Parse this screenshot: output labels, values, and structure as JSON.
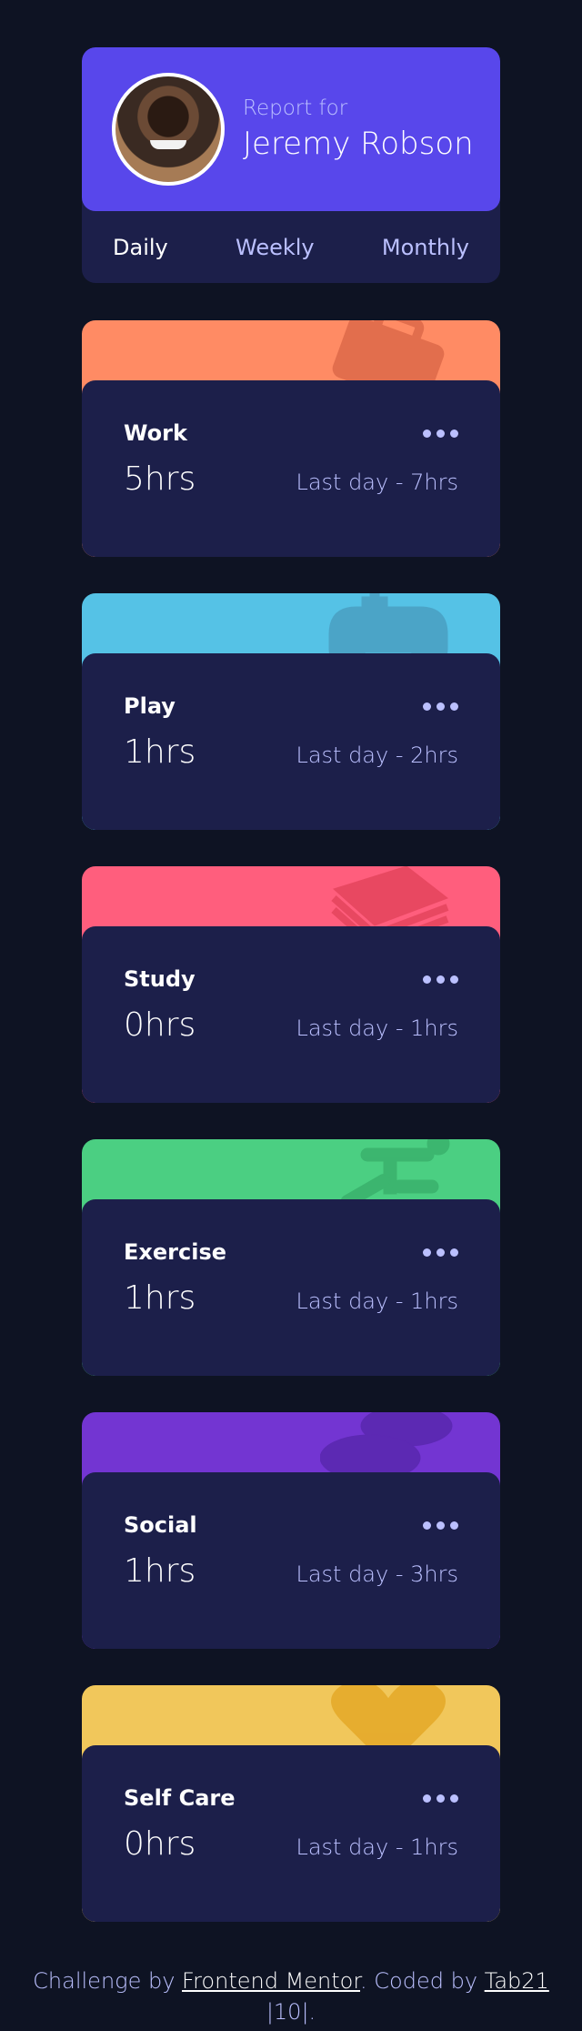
{
  "profile": {
    "report_for": "Report for",
    "name": "Jeremy Robson",
    "avatar_alt": "Jeremy Robson",
    "tabs": [
      "Daily",
      "Weekly",
      "Monthly"
    ],
    "active_tab": "Daily"
  },
  "cards": [
    {
      "title": "Work",
      "hours": "5hrs",
      "previous": "Last day - 7hrs",
      "color": "#ff8b64",
      "icon": "briefcase-icon",
      "icon_color": "#df6b4b"
    },
    {
      "title": "Play",
      "hours": "1hrs",
      "previous": "Last day - 2hrs",
      "color": "#55c2e6",
      "icon": "gamepad-icon",
      "icon_color": "#4aa1c4"
    },
    {
      "title": "Study",
      "hours": "0hrs",
      "previous": "Last day - 1hrs",
      "color": "#ff5e7d",
      "icon": "book-icon",
      "icon_color": "#e6465f"
    },
    {
      "title": "Exercise",
      "hours": "1hrs",
      "previous": "Last day - 1hrs",
      "color": "#4bcf82",
      "icon": "running-icon",
      "icon_color": "#3bb36d"
    },
    {
      "title": "Social",
      "hours": "1hrs",
      "previous": "Last day - 3hrs",
      "color": "#7335d2",
      "icon": "chat-icon",
      "icon_color": "#5a28b0"
    },
    {
      "title": "Self Care",
      "hours": "0hrs",
      "previous": "Last day - 1hrs",
      "color": "#f1c75b",
      "icon": "heart-icon",
      "icon_color": "#e5aa2b"
    }
  ],
  "footer": {
    "prefix": "Challenge by ",
    "link1": "Frontend Mentor",
    "middle": ". Coded by ",
    "link2": "Tab21",
    "suffix": "|10|."
  }
}
